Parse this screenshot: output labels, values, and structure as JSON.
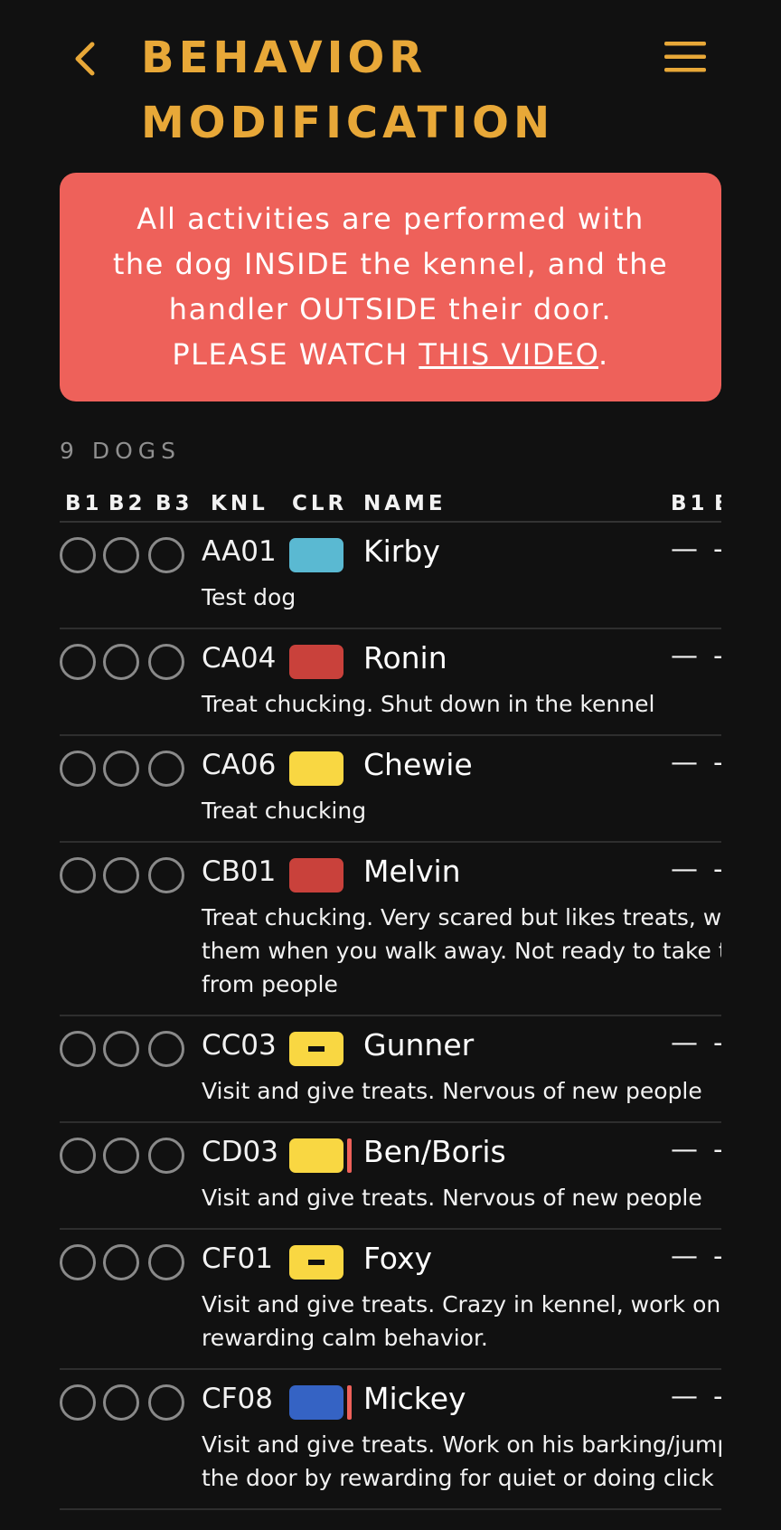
{
  "header": {
    "title_line1": "BEHAVIOR",
    "title_line2": "MODIFICATION"
  },
  "alert": {
    "line1": "All activities are performed with",
    "line2": "the dog INSIDE the kennel, and the",
    "line3": "handler OUTSIDE their door.",
    "line4_prefix": "PLEASE WATCH ",
    "link": "THIS VIDEO",
    "line4_suffix": "."
  },
  "count_label": "9 DOGS",
  "columns": {
    "b1": "B1",
    "b2": "B2",
    "b3": "B3",
    "knl": "KNL",
    "clr": "CLR",
    "name": "NAME",
    "col_b1": "B1",
    "col_b2": "B"
  },
  "colors": {
    "accent": "#e8a838",
    "alert_bg": "#ee615a",
    "background": "#111111",
    "cyan": "#5ab9d2",
    "red": "#c9413b",
    "yellow": "#f9d742",
    "blue": "#3563c4"
  },
  "dogs": [
    {
      "kennel": "AA01",
      "color": "#5ab9d2",
      "dash": false,
      "flag": false,
      "name": "Kirby",
      "b1": "—",
      "b2": "-",
      "note": "Test dog"
    },
    {
      "kennel": "CA04",
      "color": "#c9413b",
      "dash": false,
      "flag": false,
      "name": "Ronin",
      "b1": "—",
      "b2": "-",
      "note": "Treat chucking. Shut down in the kennel"
    },
    {
      "kennel": "CA06",
      "color": "#f9d742",
      "dash": false,
      "flag": false,
      "name": "Chewie",
      "b1": "—",
      "b2": "-",
      "note": "Treat chucking"
    },
    {
      "kennel": "CB01",
      "color": "#c9413b",
      "dash": false,
      "flag": false,
      "name": "Melvin",
      "b1": "—",
      "b2": "-",
      "note": "Treat chucking. Very scared but likes treats, will e\nthem when you walk away. Not ready to take tre\nfrom people"
    },
    {
      "kennel": "CC03",
      "color": "#f9d742",
      "dash": true,
      "flag": false,
      "name": "Gunner",
      "b1": "—",
      "b2": "-",
      "note": "Visit and give treats. Nervous of new people"
    },
    {
      "kennel": "CD03",
      "color": "#f9d742",
      "dash": false,
      "flag": true,
      "name": "Ben/Boris",
      "b1": "—",
      "b2": "-",
      "note": "Visit and give treats. Nervous of new people"
    },
    {
      "kennel": "CF01",
      "color": "#f9d742",
      "dash": true,
      "flag": false,
      "name": "Foxy",
      "b1": "—",
      "b2": "-",
      "note": "Visit and give treats. Crazy in kennel, work on\nrewarding calm behavior."
    },
    {
      "kennel": "CF08",
      "color": "#3563c4",
      "dash": false,
      "flag": true,
      "name": "Mickey",
      "b1": "—",
      "b2": "-",
      "note": "Visit and give treats. Work on his barking/jumpin\nthe door by rewarding for quiet or doing click fo"
    }
  ]
}
